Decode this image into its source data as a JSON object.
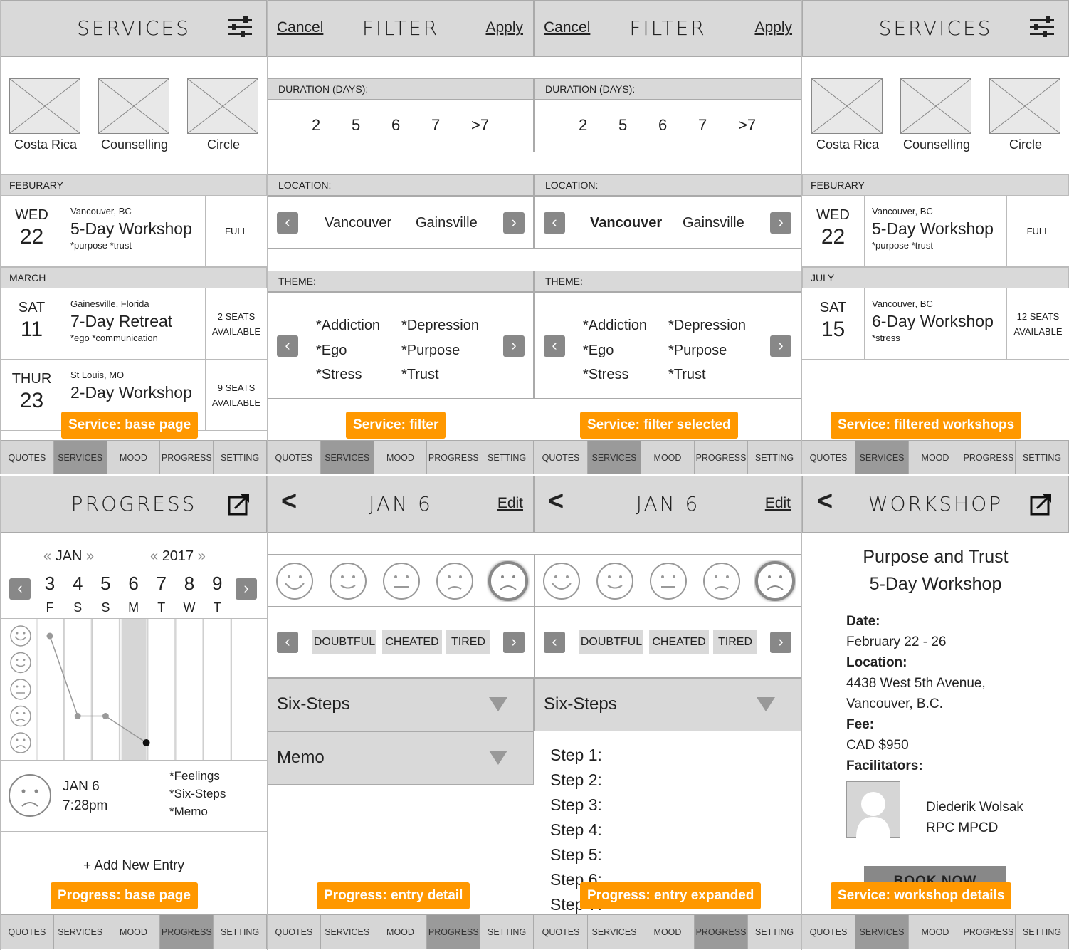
{
  "tabs": [
    "QUOTES",
    "SERVICES",
    "MOOD",
    "PROGRESS",
    "SETTING"
  ],
  "screens": {
    "s1": {
      "title": "SERVICES",
      "thumbs": [
        "Costa Rica",
        "Counselling",
        "Circle"
      ],
      "months": [
        "FEBURARY",
        "MARCH"
      ],
      "events": [
        {
          "dow": "WED",
          "day": "22",
          "loc": "Vancouver, BC",
          "name": "5-Day Workshop",
          "tags": "*purpose *trust",
          "status": "FULL",
          "status2": ""
        },
        {
          "dow": "SAT",
          "day": "11",
          "loc": "Gainesville, Florida",
          "name": "7-Day Retreat",
          "tags": "*ego *communication",
          "status": "2 SEATS",
          "status2": "AVAILABLE"
        },
        {
          "dow": "THUR",
          "day": "23",
          "loc": "St Louis, MO",
          "name": "2-Day Workshop",
          "tags": "",
          "status": "9 SEATS",
          "status2": "AVAILABLE"
        }
      ],
      "badge": "Service: base page"
    },
    "s2": {
      "cancel": "Cancel",
      "title": "FILTER",
      "apply": "Apply",
      "duration_label": "DURATION (DAYS):",
      "durations": [
        "2",
        "5",
        "6",
        "7",
        ">7"
      ],
      "location_label": "LOCATION:",
      "locations": [
        "Vancouver",
        "Gainsville"
      ],
      "theme_label": "THEME:",
      "themes": [
        "*Addiction",
        "*Depression",
        "*Ego",
        "*Purpose",
        "*Stress",
        "*Trust"
      ],
      "badge": "Service: filter"
    },
    "s3": {
      "badge": "Service: filter selected"
    },
    "s4": {
      "title": "SERVICES",
      "months": [
        "FEBURARY",
        "JULY"
      ],
      "events": [
        {
          "dow": "WED",
          "day": "22",
          "loc": "Vancouver, BC",
          "name": "5-Day Workshop",
          "tags": "*purpose *trust",
          "status": "FULL",
          "status2": ""
        },
        {
          "dow": "SAT",
          "day": "15",
          "loc": "Vancouver, BC",
          "name": "6-Day Workshop",
          "tags": "*stress",
          "status": "12 SEATS",
          "status2": "AVAILABLE"
        }
      ],
      "badge": "Service: filtered workshops"
    },
    "p1": {
      "title": "PROGRESS",
      "month": "JAN",
      "year": "2017",
      "dates": [
        "3",
        "4",
        "5",
        "6",
        "7",
        "8",
        "9"
      ],
      "dows": [
        "F",
        "S",
        "S",
        "M",
        "T",
        "W",
        "T"
      ],
      "entry_date": "JAN 6",
      "entry_time": "7:28pm",
      "entry_items": [
        "*Feelings",
        "*Six-Steps",
        "*Memo"
      ],
      "add": "+ Add New Entry",
      "badge": "Progress: base page"
    },
    "p2": {
      "title": "JAN 6",
      "edit": "Edit",
      "chips": [
        "DOUBTFUL",
        "CHEATED",
        "TIRED"
      ],
      "acc1": "Six-Steps",
      "acc2": "Memo",
      "badge": "Progress: entry detail"
    },
    "p3": {
      "steps": [
        "Step 1:",
        "Step 2:",
        "Step 3:",
        "Step 4:",
        "Step 5:",
        "Step 6:",
        "Step 7:"
      ],
      "badge": "Progress: entry expanded"
    },
    "p4": {
      "title": "WORKSHOP",
      "name1": "Purpose and Trust",
      "name2": "5-Day Workshop",
      "date_l": "Date:",
      "date": "February 22 - 26",
      "loc_l": "Location:",
      "loc1": "4438 West 5th Avenue,",
      "loc2": "Vancouver, B.C.",
      "fee_l": "Fee:",
      "fee": "CAD $950",
      "fac_l": "Facilitators:",
      "fac1": "Diederik Wolsak",
      "fac2": "RPC MPCD",
      "book": "BOOK NOW",
      "badge": "Service: workshop details"
    }
  },
  "chart_data": {
    "type": "line",
    "x": [
      "3",
      "4",
      "5",
      "6"
    ],
    "values": [
      5,
      2,
      2,
      1
    ],
    "ylim": [
      1,
      5
    ],
    "y_levels": [
      "very happy",
      "happy",
      "neutral",
      "sad",
      "very sad"
    ]
  }
}
